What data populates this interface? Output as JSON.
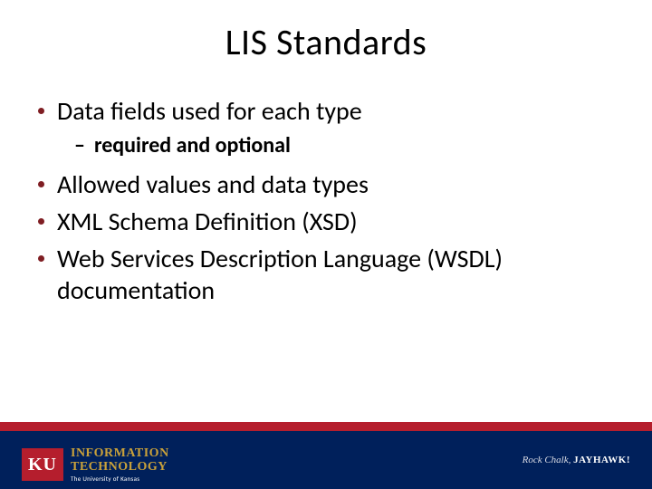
{
  "title": "LIS Standards",
  "bullets": [
    {
      "level": 1,
      "text": "Data fields used for each type"
    },
    {
      "level": 2,
      "text": "required and optional"
    },
    {
      "level": 1,
      "text": "Allowed values and data types"
    },
    {
      "level": 1,
      "text": "XML Schema Definition (XSD)"
    },
    {
      "level": 1,
      "text": "Web Services Description Language (WSDL) documentation"
    }
  ],
  "footer": {
    "logo_mark": "KU",
    "dept_line1": "INFORMATION",
    "dept_line2": "TECHNOLOGY",
    "dept_sub": "The University of Kansas",
    "tagline_italic": "Rock Chalk,",
    "tagline_bold": "JAYHAWK!"
  }
}
